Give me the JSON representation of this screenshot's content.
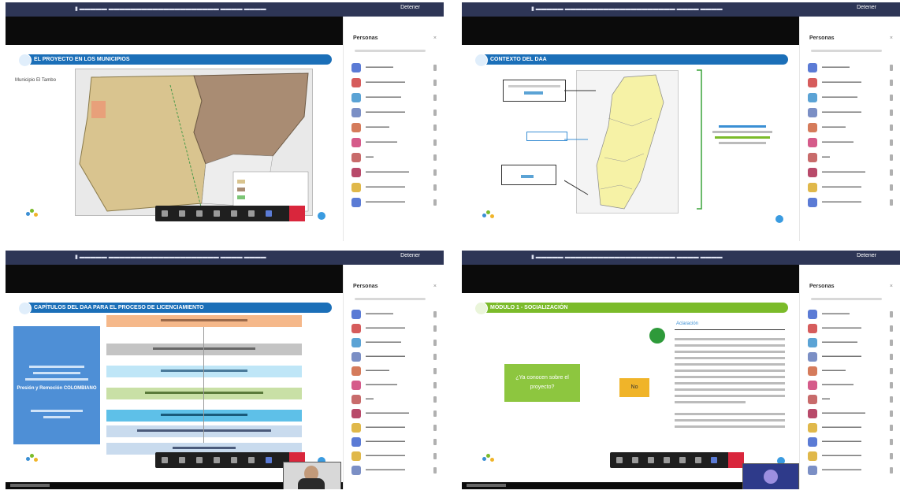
{
  "panels": {
    "p1": {
      "slide_title": "EL PROYECTO EN LOS MUNICIPIOS",
      "side_note": "Municipio El Tambo",
      "sidebar_header": "Personas",
      "sidebar_close": "×",
      "notify_button": "Detener"
    },
    "p2": {
      "slide_title": "CONTEXTO DEL DAA",
      "sidebar_header": "Personas",
      "sidebar_close": "×",
      "notify_button": "Detener"
    },
    "p3": {
      "slide_title": "CAPÍTULOS DEL DAA PARA EL PROCESO DE LICENCIAMIENTO",
      "left_box_main": "Presión y Remoción COLOMBIANO",
      "sidebar_header": "Personas",
      "sidebar_close": "×",
      "notify_button": "Detener"
    },
    "p4": {
      "slide_title": "MÓDULO 1 - SOCIALIZACIÓN",
      "green_box": "¿Ya conocen sobre el proyecto?",
      "yellow_box": "No",
      "section_label": "Aclaración",
      "sidebar_header": "Personas",
      "sidebar_close": "×",
      "notify_button": "Detener"
    }
  },
  "colors": {
    "topbar": "#2e3656",
    "slide_title_blue": "#1b6fb8",
    "slide_title_green": "#7bbb2a",
    "map_tan": "#d9c48f",
    "map_brown": "#a98c73",
    "map_yellow": "#f6f2a6",
    "end_call": "#d9263c"
  },
  "icons": [
    "record-icon",
    "mic-icon",
    "camera-icon",
    "hand-icon",
    "screen-share-icon",
    "more-icon",
    "end-call-icon"
  ]
}
